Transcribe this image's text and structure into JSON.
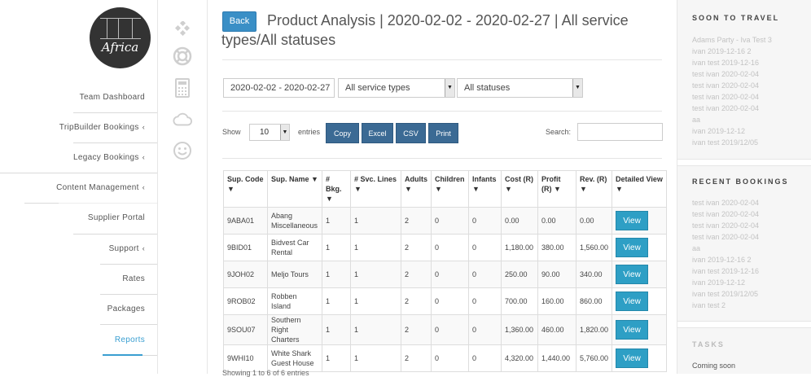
{
  "logo": {
    "text": "Africa"
  },
  "nav": {
    "items": [
      {
        "label": "Team Dashboard",
        "chevron": ""
      },
      {
        "label": "TripBuilder Bookings",
        "chevron": "‹"
      },
      {
        "label": "Legacy Bookings",
        "chevron": "‹"
      },
      {
        "label": "Content Management",
        "chevron": "‹"
      },
      {
        "label": "Supplier Portal",
        "chevron": ""
      },
      {
        "label": "Support",
        "chevron": "‹"
      },
      {
        "label": "Rates",
        "chevron": ""
      },
      {
        "label": "Packages",
        "chevron": ""
      },
      {
        "label": "Reports",
        "chevron": ""
      }
    ]
  },
  "rail_icons": [
    "puzzle-icon",
    "lifebuoy-icon",
    "calculator-icon",
    "cloud-icon",
    "smiley-icon"
  ],
  "header": {
    "back_label": "Back",
    "title_line1": "Product Analysis | 2020-02-02 - 2020-02-27 | All service",
    "title_line2": "types/All statuses"
  },
  "filters": {
    "date_range": "2020-02-02 - 2020-02-27",
    "service_type": "All service types",
    "status": "All statuses"
  },
  "table_controls": {
    "show_label": "Show",
    "entries_value": "10",
    "entries_label": "entries",
    "buttons": [
      "Copy",
      "Excel",
      "CSV",
      "Print"
    ],
    "search_label": "Search:"
  },
  "table": {
    "columns": [
      "Sup. Code ▼",
      "Sup. Name ▼",
      "# Bkg. ▼",
      "# Svc. Lines ▼",
      "Adults ▼",
      "Children ▼",
      "Infants ▼",
      "Cost (R) ▼",
      "Profit (R) ▼",
      "Rev. (R) ▼",
      "Detailed View ▼"
    ],
    "view_label": "View",
    "rows": [
      [
        "9ABA01",
        "Abang Miscellaneous",
        "1",
        "1",
        "2",
        "0",
        "0",
        "0.00",
        "0.00",
        "0.00"
      ],
      [
        "9BID01",
        "Bidvest Car Rental",
        "1",
        "1",
        "2",
        "0",
        "0",
        "1,180.00",
        "380.00",
        "1,560.00"
      ],
      [
        "9JOH02",
        "Meljo Tours",
        "1",
        "1",
        "2",
        "0",
        "0",
        "250.00",
        "90.00",
        "340.00"
      ],
      [
        "9ROB02",
        "Robben Island",
        "1",
        "1",
        "2",
        "0",
        "0",
        "700.00",
        "160.00",
        "860.00"
      ],
      [
        "9SOU07",
        "Southern Right Charters",
        "1",
        "1",
        "2",
        "0",
        "0",
        "1,360.00",
        "460.00",
        "1,820.00"
      ],
      [
        "9WHI10",
        "White Shark Guest House",
        "1",
        "1",
        "2",
        "0",
        "0",
        "4,320.00",
        "1,440.00",
        "5,760.00"
      ]
    ],
    "footer": "Showing 1 to 6 of 6 entries"
  },
  "sidebar": {
    "soon_title": "SOON TO TRAVEL",
    "soon_items": [
      "Adams Party - Iva Test 3",
      "ivan 2019-12-16 2",
      "ivan test 2019-12-16",
      "test ivan 2020-02-04",
      "test ivan 2020-02-04",
      "test ivan 2020-02-04",
      "test ivan 2020-02-04",
      "aa",
      "ivan 2019-12-12",
      "ivan test 2019/12/05"
    ],
    "recent_title": "RECENT BOOKINGS",
    "recent_items": [
      "test ivan 2020-02-04",
      "test ivan 2020-02-04",
      "test ivan 2020-02-04",
      "test ivan 2020-02-04",
      "aa",
      "ivan 2019-12-16 2",
      "ivan test 2019-12-16",
      "ivan 2019-12-12",
      "ivan test 2019/12/05",
      "ivan test 2"
    ],
    "tasks_title": "TASKS",
    "tasks_text": "Coming soon"
  },
  "colors": {
    "accent": "#3a9fd1",
    "button_dark": "#3b6a94",
    "view_button": "#2e9fc5",
    "back_button": "#3a8fc6"
  }
}
